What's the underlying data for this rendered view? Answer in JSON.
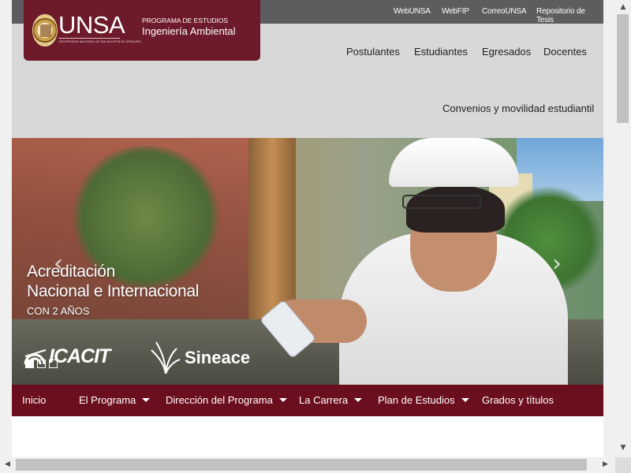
{
  "topbar": {
    "links": [
      "WebUNSA",
      "WebFIP",
      "CorreoUNSA",
      "Repositorio de Tesis"
    ]
  },
  "logo": {
    "word": "UNSA",
    "sub": "UNIVERSIDAD NACIONAL DE SAN AGUSTIN DE AREQUIPA",
    "program_label": "PROGRAMA DE ESTUDIOS",
    "program_name": "Ingeniería Ambiental"
  },
  "nav": {
    "items": [
      "Postulantes",
      "Estudiantes",
      "Egresados",
      "Docentes"
    ],
    "extra": "Convenios y movilidad estudiantil"
  },
  "hero": {
    "line1": "Acreditación",
    "line2": "Nacional e Internacional",
    "line3": "CON 2 AÑOS",
    "logo1": "ICACIT",
    "logo2": "Sineace",
    "prev_icon": "chevron-left-icon",
    "next_icon": "chevron-right-icon",
    "slide_count": 3,
    "active_slide": 1
  },
  "menu": {
    "items": [
      {
        "label": "Inicio",
        "dropdown": false
      },
      {
        "label": "El Programa",
        "dropdown": true
      },
      {
        "label": "Dirección del Programa",
        "dropdown": true
      },
      {
        "label": "La Carrera",
        "dropdown": true
      },
      {
        "label": "Plan de Estudios",
        "dropdown": true
      },
      {
        "label": "Grados y títulos",
        "dropdown": false
      }
    ]
  },
  "colors": {
    "brand": "#6b0e1e",
    "topbar": "#5d5d5f",
    "page_bg": "#d8d8d8"
  }
}
